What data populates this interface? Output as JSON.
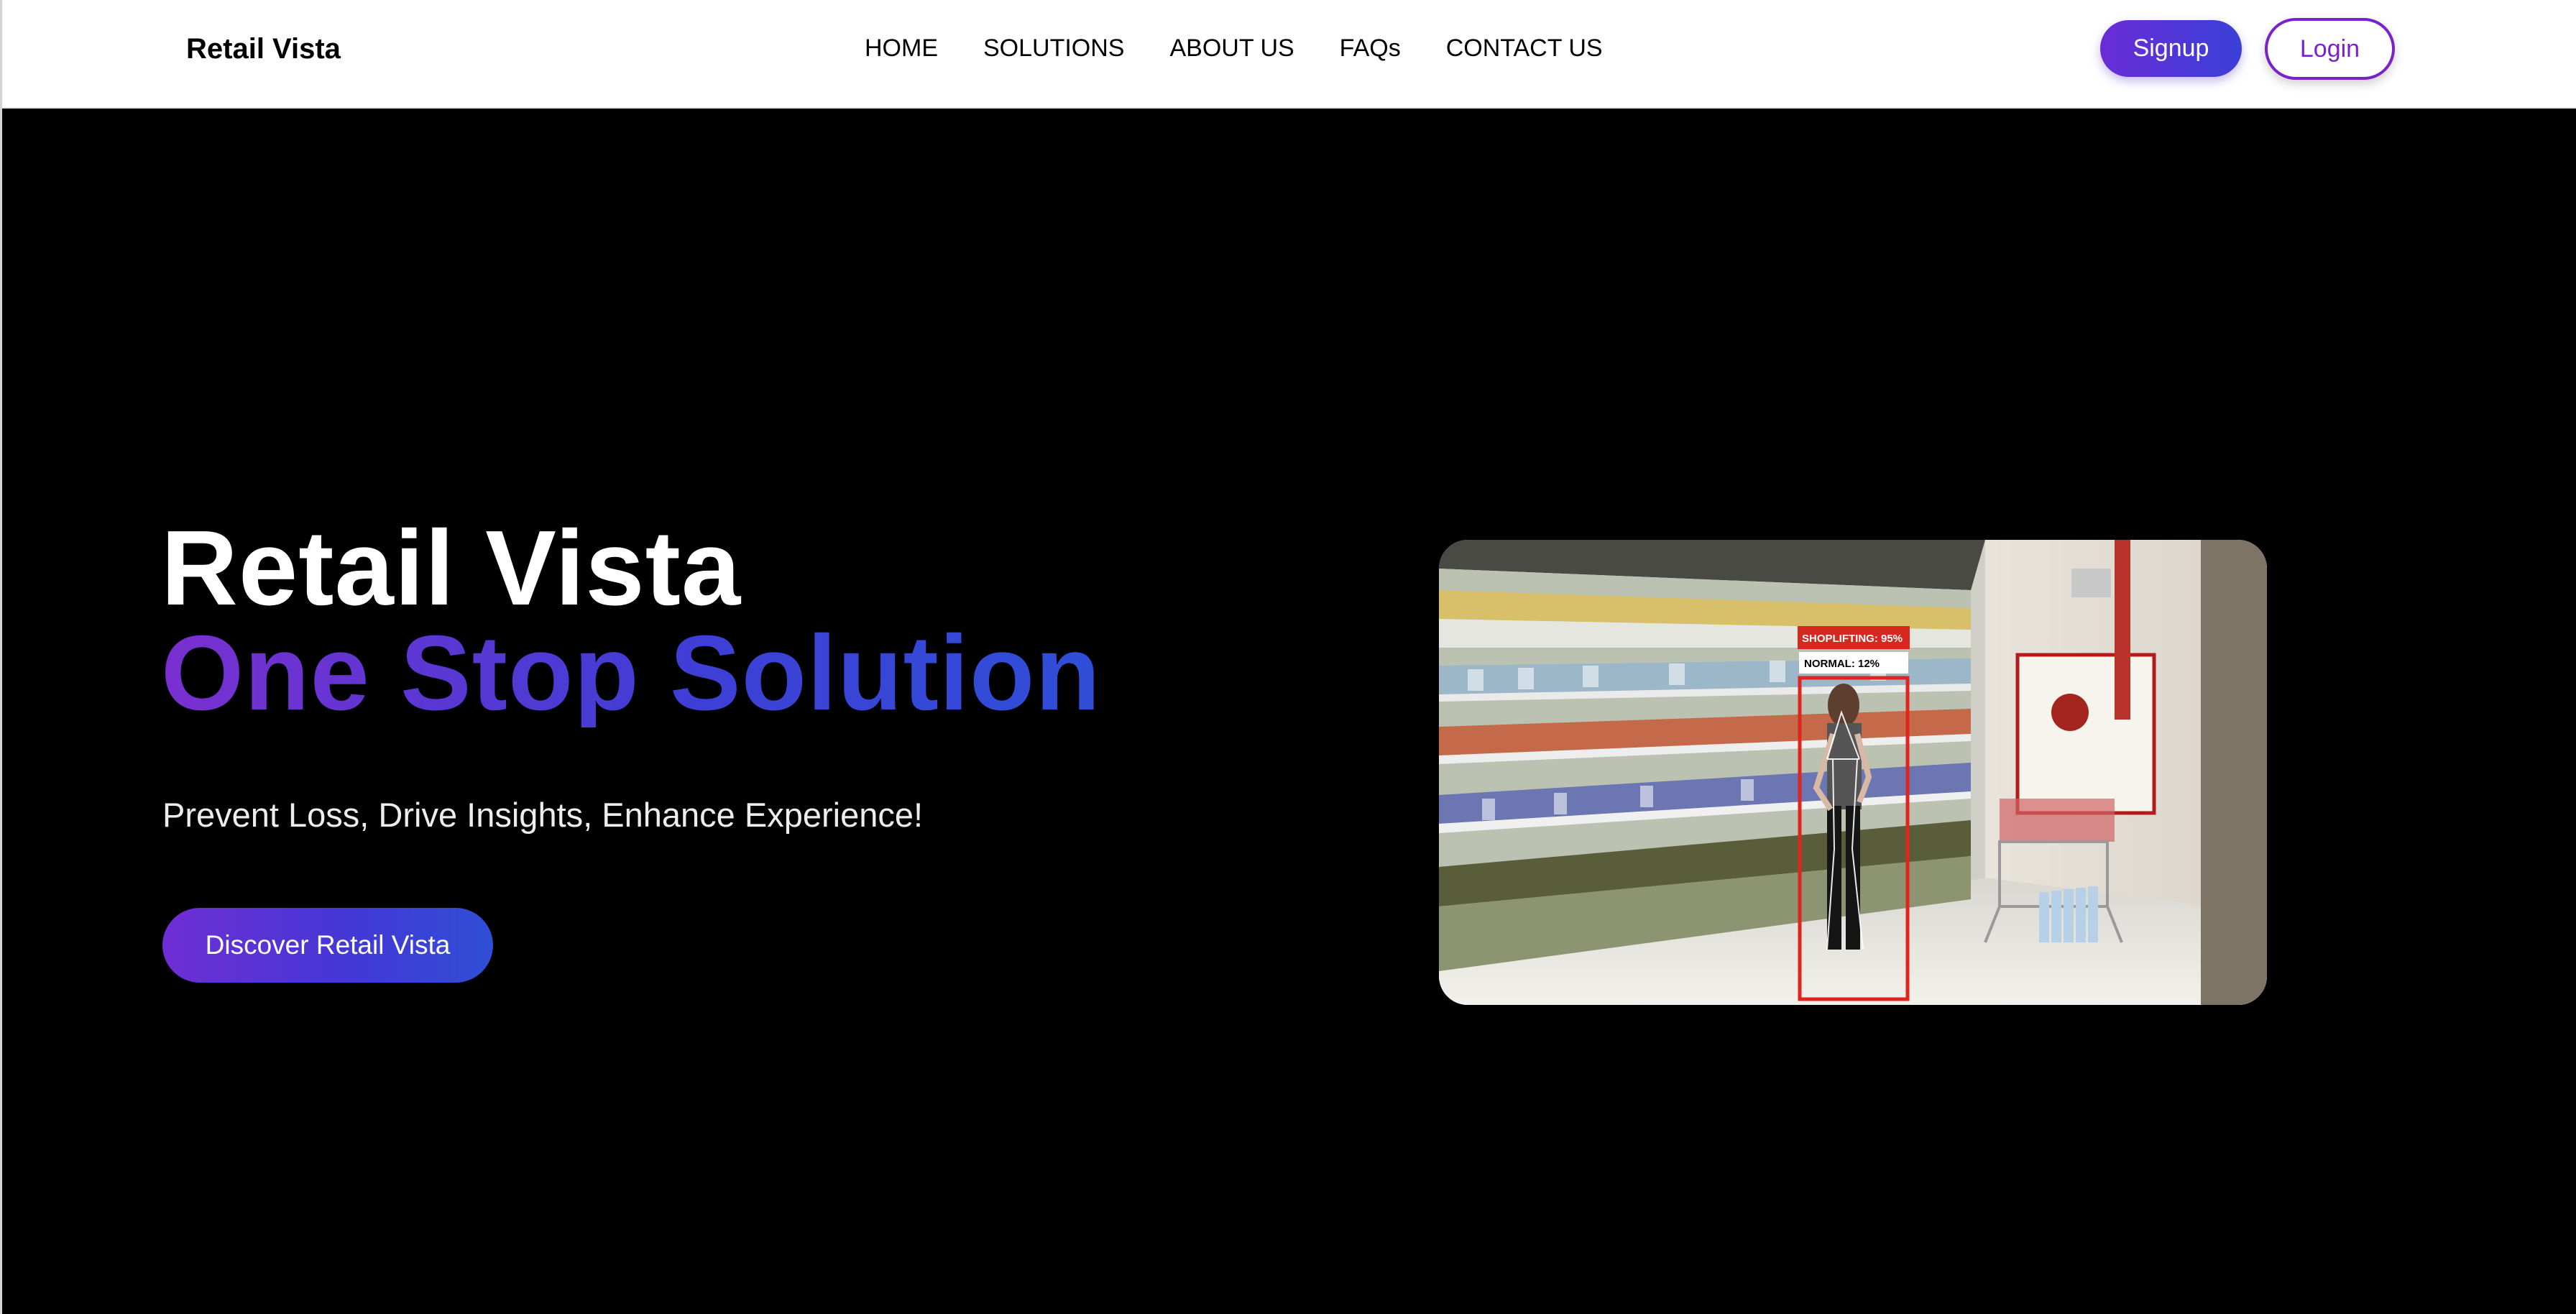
{
  "header": {
    "brand": "Retail Vista",
    "nav": [
      "HOME",
      "SOLUTIONS",
      "ABOUT US",
      "FAQs",
      "CONTACT US"
    ],
    "signup_label": "Signup",
    "login_label": "Login"
  },
  "hero": {
    "title": "Retail Vista",
    "subtitle": "One Stop Solution",
    "tagline": "Prevent Loss, Drive Insights, Enhance Experience!",
    "cta_label": "Discover Retail Vista",
    "detection": {
      "label_primary": "SHOPLIFTING: 95%",
      "label_secondary": "NORMAL: 12%"
    }
  },
  "colors": {
    "accent_start": "#6a2cd6",
    "accent_end": "#2f4fd8",
    "login_border": "#7a22c9",
    "detection_box": "#e0251f"
  }
}
